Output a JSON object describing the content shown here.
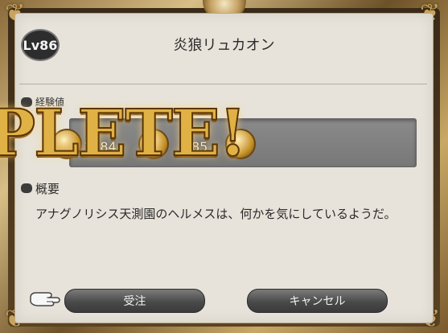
{
  "dialog": {
    "level": "Lv86",
    "title": "炎狼リュカオン",
    "reward_label": "経験値",
    "reward_values": [
      "1884",
      "85"
    ],
    "overlay_text": "PLETE!",
    "section_title": "概要",
    "description": "アナグノリシス天測園のヘルメスは、何かを気にしているようだ。"
  },
  "buttons": {
    "accept": "受注",
    "cancel": "キャンセル"
  }
}
